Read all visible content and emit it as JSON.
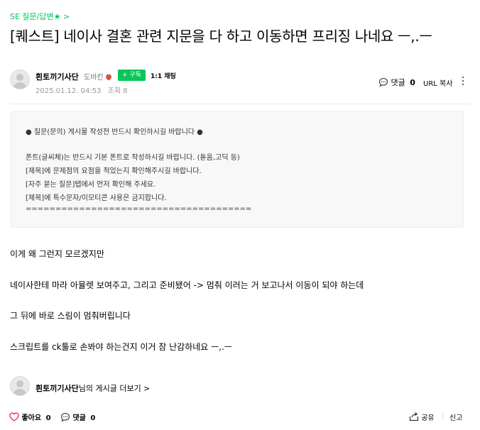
{
  "header": {
    "category": "SE 질문/답변★ >",
    "title": "[퀘스트] 네이사 결혼 관련 지문을 다 하고 이동하면 프리징 나네요 ㅡ,.ㅡ"
  },
  "author": {
    "name": "흰토끼기사단",
    "grade": "도바킨",
    "subscribe_label": "+ 구독",
    "chat_label": "1:1 채팅",
    "date": "2025.01.12. 04:53",
    "views": "조회 8"
  },
  "top_actions": {
    "comment_label": "댓글",
    "comment_count": "0",
    "url_copy_label": "URL 복사"
  },
  "notice": {
    "line1": "● 질문(문의) 게시물 작성전 반드시 확인하시길 바랍니다 ●",
    "line2": "폰트(글씨체)는 반드시 기본 폰트로 작성하시길 바랍니다. (돋움,고딕 등)",
    "line3": "[제목]에 문제점의 요점을 적었는지 확인해주시길 바랍니다.",
    "line4": "[자주 묻는 질문]탭에서 먼저 확인해 주세요.",
    "line5": "[제목]에 특수문자/이모티콘 사용은 금지합니다.",
    "line6": "======================================"
  },
  "body": {
    "p1": "이게 왜 그런지 모르겠지만",
    "p2": "네이사한테 마라 아뮬렛 보여주고, 그리고 준비됐어 -> 멈춰 이러는 거 보고나서 이동이 되야 하는데",
    "p3": "그 뒤에 바로 스림이 멈춰버립니다",
    "p4": "스크립트를 ck툴로 손봐야 하는건지 이거 참 난감하네요 ㅡ,.ㅡ"
  },
  "footer": {
    "author_name": "흰토끼기사단",
    "more_suffix": "님의 게시글 더보기 >"
  },
  "bottom_bar": {
    "like_label": "좋아요",
    "like_count": "0",
    "comment_label": "댓글",
    "comment_count": "0",
    "share_label": "공유",
    "report_label": "신고"
  },
  "colors": {
    "accent_green": "#03c75a",
    "like_red": "#e0284f"
  }
}
